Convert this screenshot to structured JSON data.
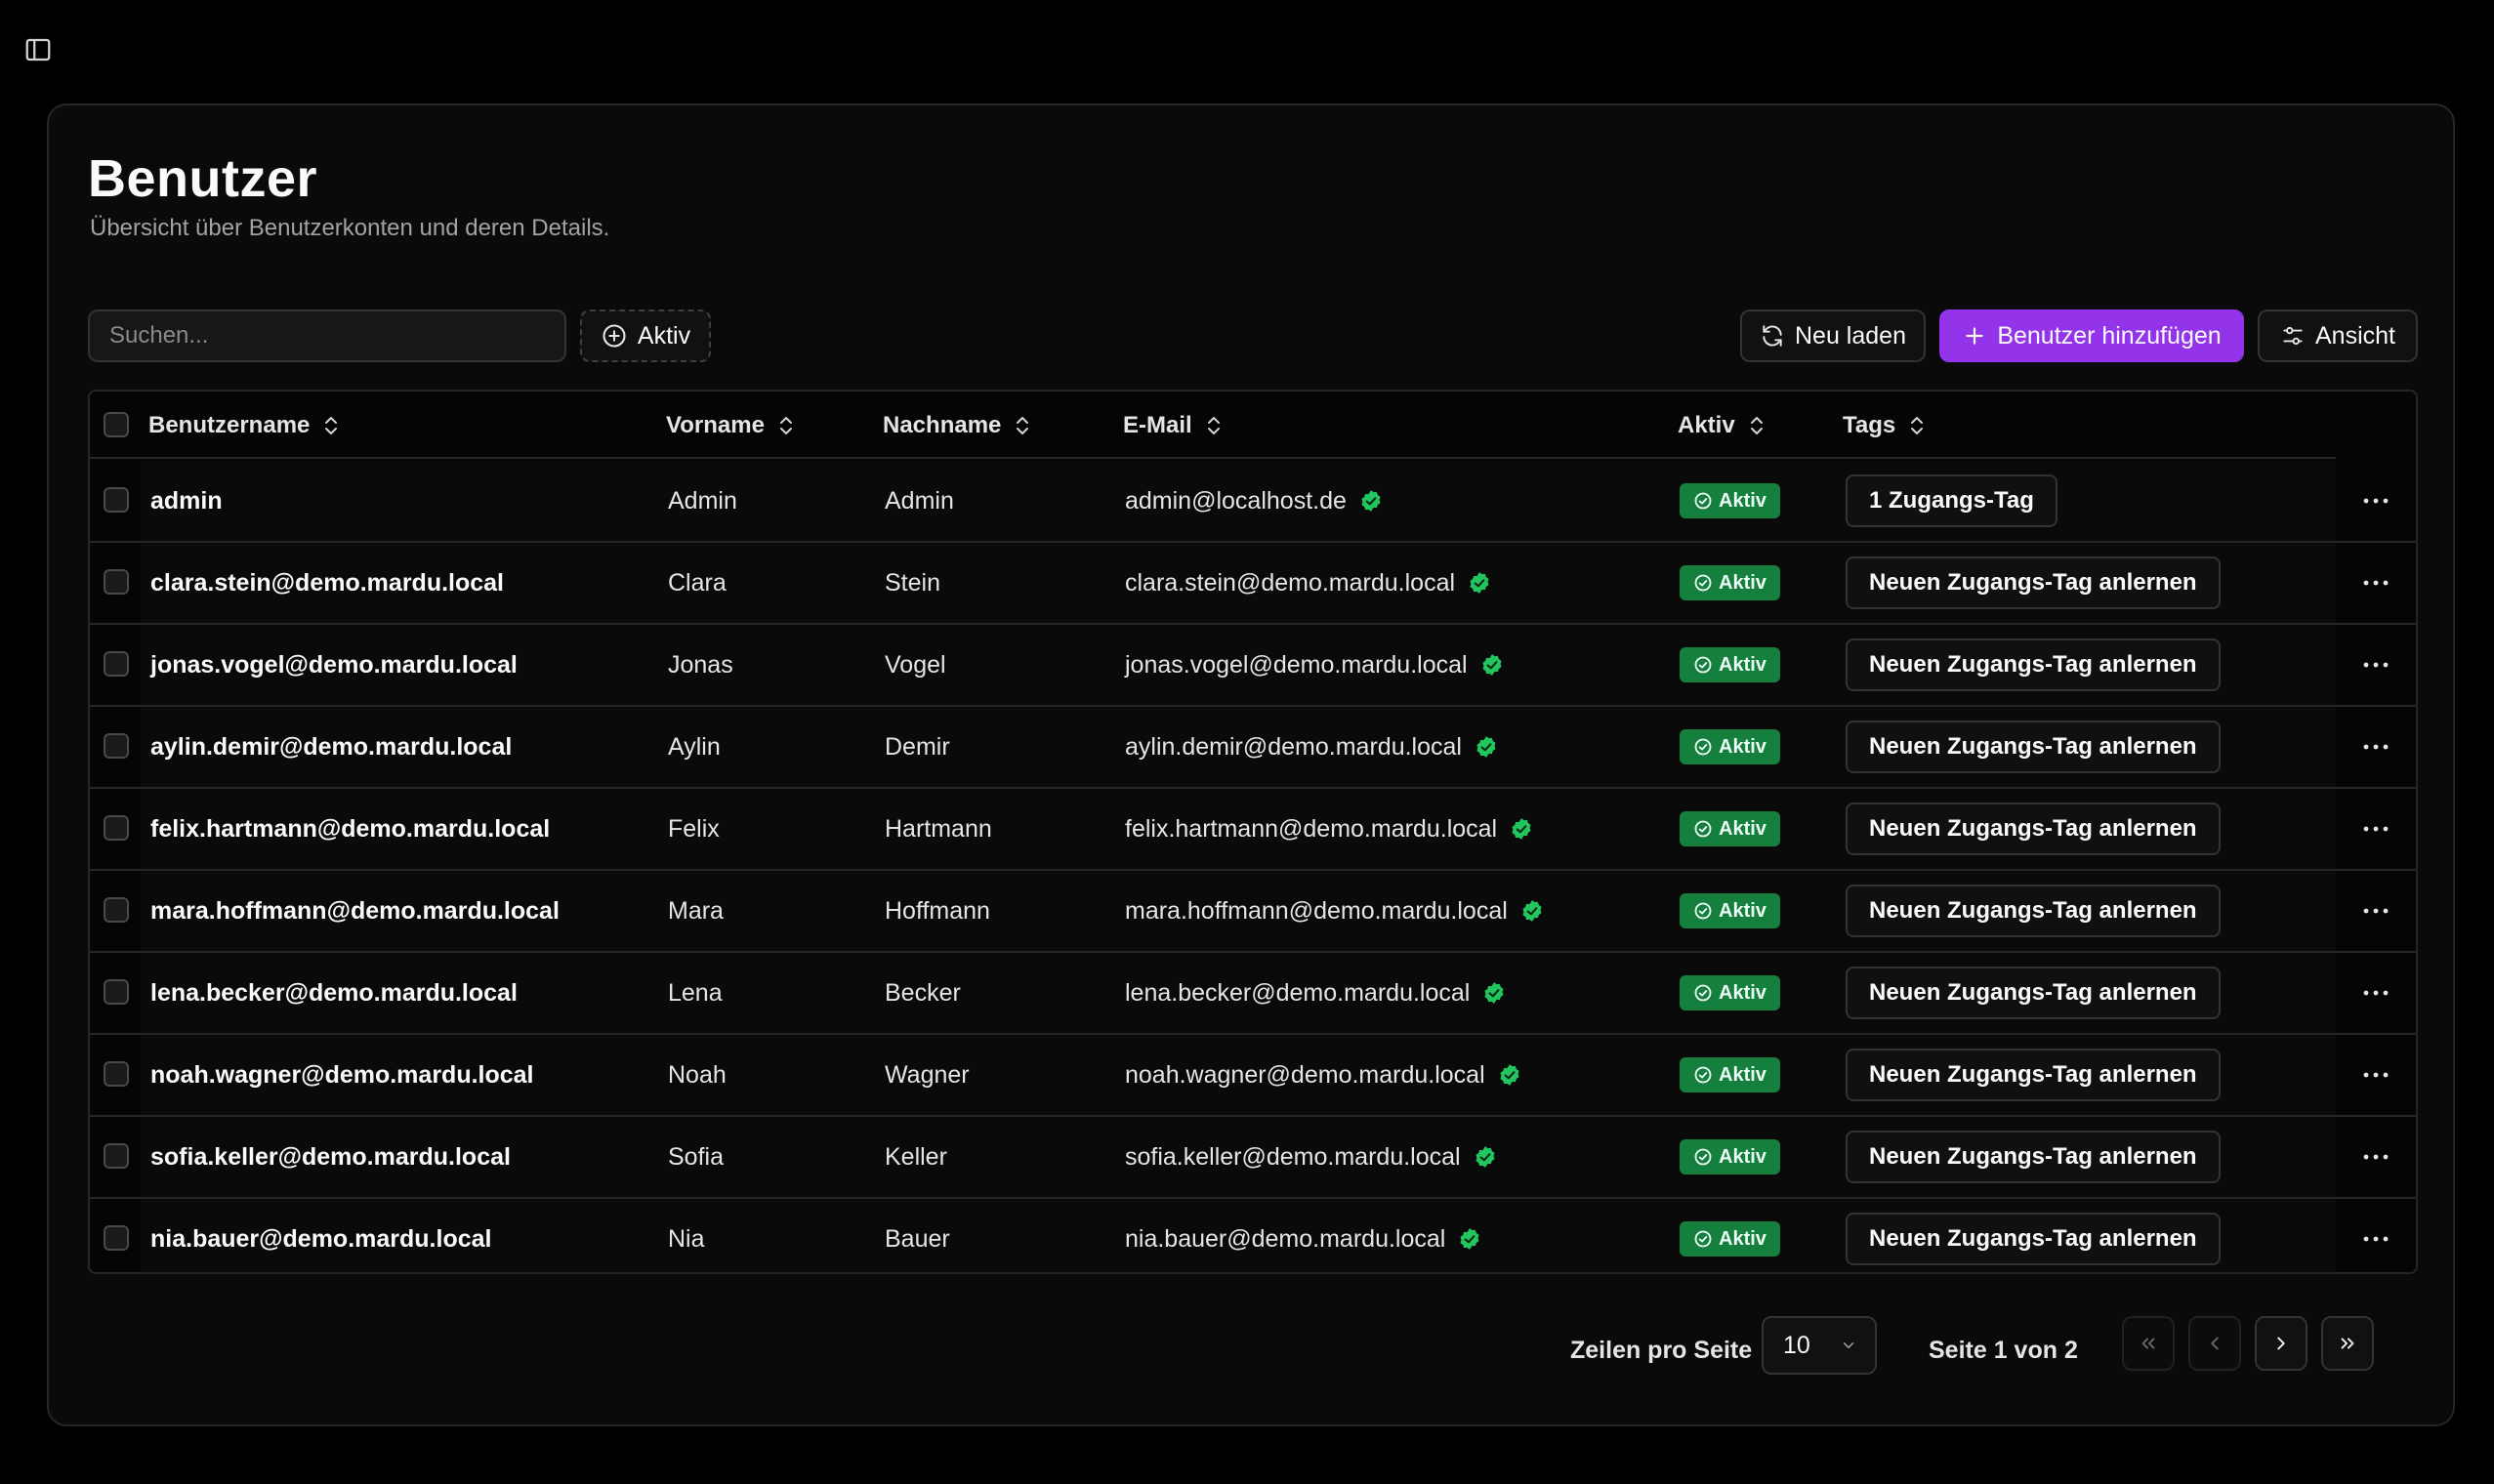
{
  "page": {
    "title": "Benutzer",
    "subtitle": "Übersicht über Benutzerkonten und deren Details."
  },
  "toolbar": {
    "search_placeholder": "Suchen...",
    "filter_label": "Aktiv",
    "reload_label": "Neu laden",
    "add_label": "Benutzer hinzufügen",
    "view_label": "Ansicht"
  },
  "colors": {
    "accent": "#9333ea",
    "active_badge": "#15803d",
    "verified": "#22c55e"
  },
  "table": {
    "columns": {
      "username": "Benutzername",
      "firstname": "Vorname",
      "lastname": "Nachname",
      "email": "E-Mail",
      "active": "Aktiv",
      "tags": "Tags"
    },
    "rows": [
      {
        "username": "admin",
        "firstname": "Admin",
        "lastname": "Admin",
        "email": "admin@localhost.de",
        "active": "Aktiv",
        "tag": "1 Zugangs-Tag"
      },
      {
        "username": "clara.stein@demo.mardu.local",
        "firstname": "Clara",
        "lastname": "Stein",
        "email": "clara.stein@demo.mardu.local",
        "active": "Aktiv",
        "tag": "Neuen Zugangs-Tag anlernen"
      },
      {
        "username": "jonas.vogel@demo.mardu.local",
        "firstname": "Jonas",
        "lastname": "Vogel",
        "email": "jonas.vogel@demo.mardu.local",
        "active": "Aktiv",
        "tag": "Neuen Zugangs-Tag anlernen"
      },
      {
        "username": "aylin.demir@demo.mardu.local",
        "firstname": "Aylin",
        "lastname": "Demir",
        "email": "aylin.demir@demo.mardu.local",
        "active": "Aktiv",
        "tag": "Neuen Zugangs-Tag anlernen"
      },
      {
        "username": "felix.hartmann@demo.mardu.local",
        "firstname": "Felix",
        "lastname": "Hartmann",
        "email": "felix.hartmann@demo.mardu.local",
        "active": "Aktiv",
        "tag": "Neuen Zugangs-Tag anlernen"
      },
      {
        "username": "mara.hoffmann@demo.mardu.local",
        "firstname": "Mara",
        "lastname": "Hoffmann",
        "email": "mara.hoffmann@demo.mardu.local",
        "active": "Aktiv",
        "tag": "Neuen Zugangs-Tag anlernen"
      },
      {
        "username": "lena.becker@demo.mardu.local",
        "firstname": "Lena",
        "lastname": "Becker",
        "email": "lena.becker@demo.mardu.local",
        "active": "Aktiv",
        "tag": "Neuen Zugangs-Tag anlernen"
      },
      {
        "username": "noah.wagner@demo.mardu.local",
        "firstname": "Noah",
        "lastname": "Wagner",
        "email": "noah.wagner@demo.mardu.local",
        "active": "Aktiv",
        "tag": "Neuen Zugangs-Tag anlernen"
      },
      {
        "username": "sofia.keller@demo.mardu.local",
        "firstname": "Sofia",
        "lastname": "Keller",
        "email": "sofia.keller@demo.mardu.local",
        "active": "Aktiv",
        "tag": "Neuen Zugangs-Tag anlernen"
      },
      {
        "username": "nia.bauer@demo.mardu.local",
        "firstname": "Nia",
        "lastname": "Bauer",
        "email": "nia.bauer@demo.mardu.local",
        "active": "Aktiv",
        "tag": "Neuen Zugangs-Tag anlernen"
      }
    ]
  },
  "pagination": {
    "rows_per_page_label": "Zeilen pro Seite",
    "rows_per_page_value": "10",
    "page_info": "Seite 1 von 2"
  }
}
